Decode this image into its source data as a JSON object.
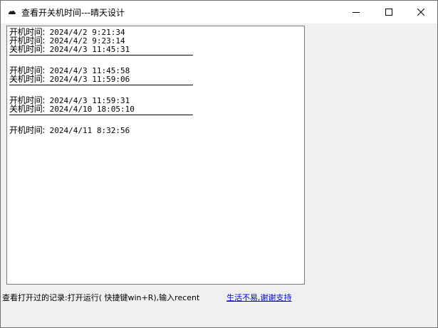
{
  "window": {
    "title": "查看开关机时间---晴天设计",
    "icon": "cloud-icon",
    "controls": [
      "minimize-icon",
      "maximize-icon",
      "close-icon"
    ]
  },
  "log": {
    "groups": [
      [
        {
          "label": "开机时间:",
          "value": " 2024/4/2 9:21:34"
        },
        {
          "label": "开机时间:",
          "value": " 2024/4/2 9:23:14"
        },
        {
          "label": "关机时间:",
          "value": " 2024/4/3 11:45:31"
        }
      ],
      [
        {
          "label": "开机时间:",
          "value": " 2024/4/3 11:45:58"
        },
        {
          "label": "关机时间:",
          "value": " 2024/4/3 11:59:06"
        }
      ],
      [
        {
          "label": "开机时间:",
          "value": " 2024/4/3 11:59:31"
        },
        {
          "label": "关机时间:",
          "value": " 2024/4/10 18:05:10"
        }
      ],
      [
        {
          "label": "开机时间:",
          "value": " 2024/4/11 8:32:56"
        }
      ]
    ]
  },
  "footer": {
    "hint": "查看打开过的记录:打开运行( 快捷键win+R),输入recent",
    "link": "生活不易,谢谢支持"
  }
}
